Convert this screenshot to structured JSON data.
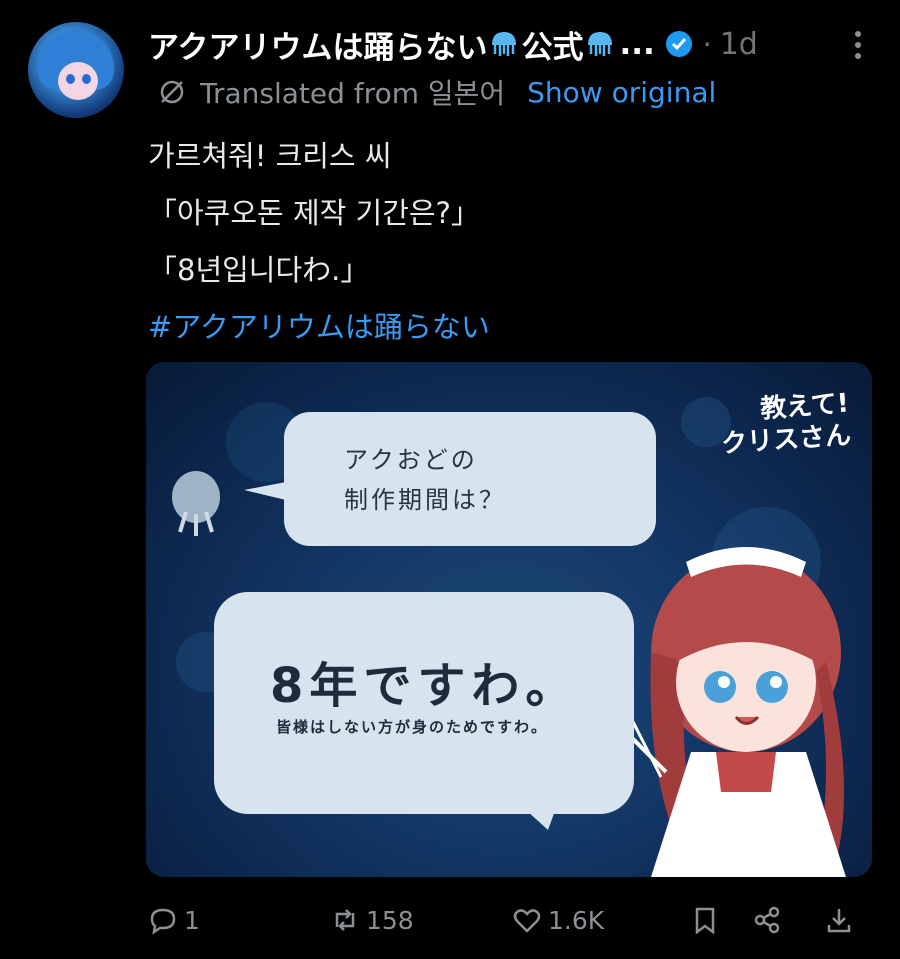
{
  "post": {
    "author_name": "アクアリウムは踊らない",
    "author_suffix": "公式",
    "ellipsis": "...",
    "dot": "·",
    "time": "1d",
    "translated_label": "Translated from 일본어",
    "show_original": "Show original",
    "lines": [
      "가르쳐줘! 크리스 씨",
      "「아쿠오돈 제작 기간은?」",
      "「8년입니다わ.」"
    ],
    "hashtag": "#アクアリウムは踊らない"
  },
  "media": {
    "bubble1_line1": "アクおどの",
    "bubble1_line2": "制作期間は？",
    "bubble2_big": "8年ですわ。",
    "bubble2_small": "皆様はしない方が身のためですわ。",
    "title_line1": "教えて!",
    "title_line2": "クリスさん"
  },
  "actions": {
    "replies": "1",
    "reposts": "158",
    "likes": "1.6K"
  },
  "icons": [
    "globe-icon",
    "verified-icon",
    "more-icon",
    "reply-icon",
    "repost-icon",
    "like-icon",
    "bookmark-icon",
    "share-icon",
    "download-icon",
    "jellyfish-icon"
  ],
  "colors": {
    "accent": "#3a9af2",
    "muted": "#71767b",
    "background": "#000000"
  }
}
